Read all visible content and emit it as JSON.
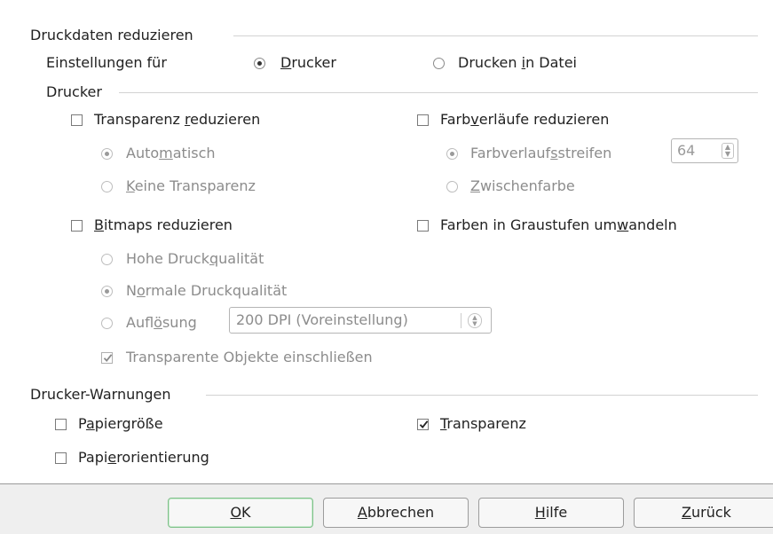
{
  "section_reduce": {
    "title": "Druckdaten reduzieren",
    "settings_for_label": "Einstellungen für",
    "option_printer": "Drucker",
    "option_print_to_file": "Drucken in Datei",
    "selected": "Drucker"
  },
  "printer": {
    "title": "Drucker",
    "reduce_transparency": {
      "label": "Transparenz reduzieren",
      "checked": false
    },
    "transparency_auto": {
      "label": "Automatisch",
      "selected": true,
      "disabled": true
    },
    "transparency_none": {
      "label": "Keine Transparenz",
      "selected": false,
      "disabled": true
    },
    "reduce_gradients": {
      "label": "Farbverläufe reduzieren",
      "checked": false
    },
    "gradient_stripes": {
      "label": "Farbverlaufsstreifen",
      "selected": true,
      "disabled": true,
      "value": "64"
    },
    "intermediate_color": {
      "label": "Zwischenfarbe",
      "selected": false,
      "disabled": true
    },
    "reduce_bitmaps": {
      "label": "Bitmaps reduzieren",
      "checked": false
    },
    "grayscale": {
      "label": "Farben in Graustufen umwandeln",
      "checked": false
    },
    "high_quality": {
      "label": "Hohe Druckqualität",
      "selected": false,
      "disabled": true
    },
    "normal_quality": {
      "label": "Normale Druckqualität",
      "selected": true,
      "disabled": true
    },
    "resolution": {
      "label": "Auflösung",
      "selected": false,
      "disabled": true,
      "value": "200 DPI (Voreinstellung)"
    },
    "include_transparent": {
      "label": "Transparente Objekte einschließen",
      "checked": true,
      "disabled": true
    }
  },
  "warnings": {
    "title": "Drucker-Warnungen",
    "paper_size": {
      "label": "Papiergröße",
      "checked": false
    },
    "transparency": {
      "label": "Transparenz",
      "checked": true
    },
    "paper_orientation": {
      "label": "Papierorientierung",
      "checked": false
    }
  },
  "buttons": {
    "ok": "OK",
    "cancel": "Abbrechen",
    "help": "Hilfe",
    "back": "Zurück"
  }
}
